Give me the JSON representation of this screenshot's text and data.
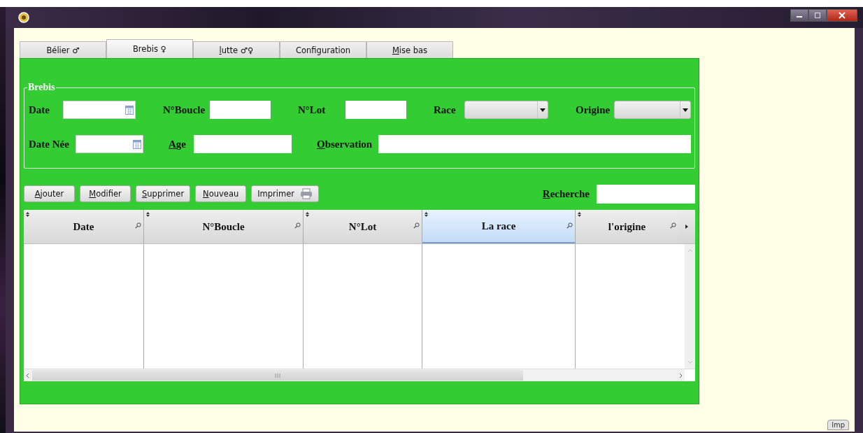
{
  "tabs": [
    {
      "label": "Bélier ♂",
      "selected": false,
      "underline_first": false
    },
    {
      "label": "Brebis ♀",
      "selected": true,
      "underline_first": false
    },
    {
      "label": "lutte ♂♀",
      "selected": false,
      "underline_first": true
    },
    {
      "label": "Configuration",
      "selected": false,
      "underline_first": false
    },
    {
      "label": "Mise bas",
      "selected": false,
      "underline_first": true
    }
  ],
  "group": {
    "title": "Brebis",
    "rows": [
      [
        {
          "label": "Date",
          "kind": "date",
          "underline_first": false
        },
        {
          "label": "N°Boucle",
          "kind": "text",
          "underline_first": false
        },
        {
          "label": "N°Lot",
          "kind": "text",
          "underline_first": false
        },
        {
          "label": "Race",
          "kind": "combo",
          "underline_first": false
        },
        {
          "label": "Origine",
          "kind": "combo",
          "underline_first": false
        }
      ],
      [
        {
          "label": "Date Née",
          "kind": "date",
          "underline_first": false
        },
        {
          "label": "Age",
          "kind": "text",
          "underline_first": true
        },
        {
          "label": "Observation",
          "kind": "text",
          "underline_first": true
        }
      ]
    ]
  },
  "buttons": [
    {
      "label": "Ajouter",
      "kind": "plain",
      "underline_first": true
    },
    {
      "label": "Modifier",
      "kind": "plain",
      "underline_first": true
    },
    {
      "label": "Supprimer",
      "kind": "plain",
      "underline_first": true
    },
    {
      "label": "Nouveau",
      "kind": "plain",
      "underline_first": true
    },
    {
      "label": "Imprimer",
      "kind": "printer",
      "underline_first": false
    }
  ],
  "search": {
    "label": "Recherche",
    "underline_first": true
  },
  "table": {
    "columns": [
      {
        "label": "Date",
        "selected": false
      },
      {
        "label": "N°Boucle",
        "selected": false
      },
      {
        "label": "N°Lot",
        "selected": false
      },
      {
        "label": "La race",
        "selected": true
      },
      {
        "label": "l'origine",
        "selected": false
      }
    ]
  },
  "corner_tag": "lmp"
}
